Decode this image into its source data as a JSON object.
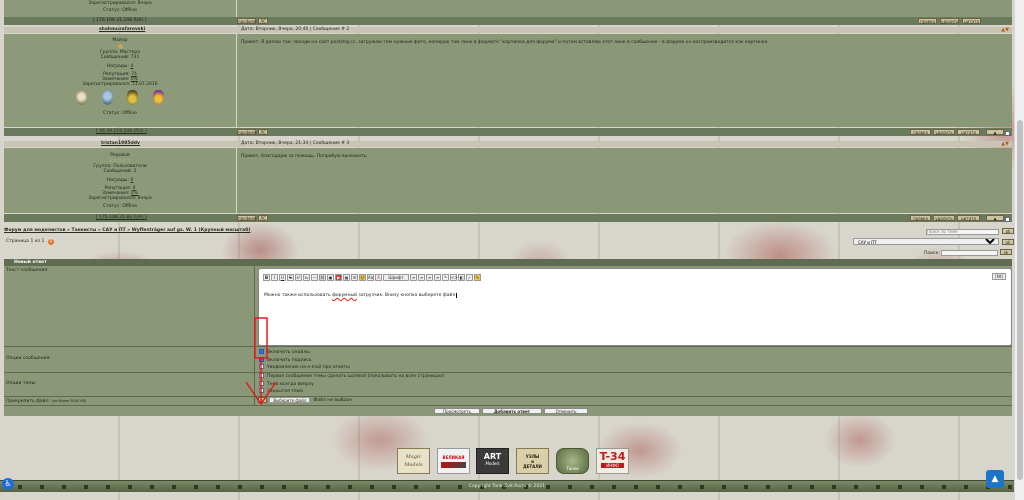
{
  "post0": {
    "registered": "Зарегистрировался: Вчера",
    "status": "Статус: Offline",
    "ip": "[ 176.108.31.248 (UA) ]",
    "btn_profile": "профиль",
    "btn_pm": "ЛС",
    "btn_edit": "правка",
    "btn_quote": "цитата"
  },
  "post1": {
    "username": "shahmuzafarovski",
    "rank": "Майор",
    "group": "Группа: Мастера",
    "messages": "Сообщений: 731",
    "awards_label": "Награды:",
    "awards_value": "4",
    "reputation_label": "Репутация:",
    "reputation_value": "74",
    "remarks_label": "Замечания:",
    "remarks_value": "0%",
    "registered": "Зарегистрировался: 11.07.2016",
    "status": "Статус: Offline",
    "meta": "Дата: Вторник, Вчера, 20:40 | Сообщение # 2",
    "text": "Привет. Я делаю так: заходи на сайт postimg.cc, загружаю там нужные фото, копирую там линк в формате \"картинка для форума\" и потом вставляю этот линк в сообщение - в форуме он воспроизводится как картинка.",
    "ip": "[ 46.39.219.248 (RU) ]",
    "btn_profile": "профиль",
    "btn_pm": "ЛС",
    "btn_edit": "правка",
    "btn_delete": "удалить",
    "btn_quote": "цитата"
  },
  "post2": {
    "username": "tristan1985ddv",
    "rank": "Рядовой",
    "group": "Группа: Пользователи",
    "messages": "Сообщений: 2",
    "awards_label": "Награды:",
    "awards_value": "0",
    "reputation_label": "Репутация:",
    "reputation_value": "0",
    "remarks_label": "Замечания:",
    "remarks_value": "0%",
    "registered": "Зарегистрировался: Вчера",
    "status": "Статус: Offline",
    "meta": "Дата: Вторник, Вчера, 21:34 | Сообщение # 3",
    "text": "Привет, благодарю за помощь. Попробую выложить.",
    "ip": "[ 176.108.31.82 (UA) ]",
    "btn_profile": "профиль",
    "btn_pm": "ЛС",
    "btn_edit": "правка",
    "btn_delete": "удалить",
    "btn_quote": "цитата"
  },
  "breadcrumb": "Форум для моделистов » Танкисты » САУ и ПТ » Wyffenträger auf gs. W. 1 (Крупный масштаб)",
  "pages_label": "Страница 1 из 1",
  "page_current": "1",
  "search_placeholder": "Поиск по теме",
  "btn_ok": "ok",
  "forum_select_value": "САУ и ПТ",
  "search2_label": "Поиск:",
  "reply": {
    "header": "Новый ответ",
    "text_label": "Текст сообщения:",
    "toolbar_font": "Шрифт",
    "toolbar_right": "[Nt]",
    "editor_text_before": "Можно также использовать ",
    "editor_link": "форумный",
    "editor_text_after": " загрузчик. Внизу кнопка выберете файл",
    "options_label": "Опции сообщения:",
    "opt_smiles": "Включить смайлы",
    "opt_signature": "Включить подпись",
    "opt_notify": "Уведомление на e-mail про ответы",
    "topic_options_label": "Опции темы:",
    "topic_opt1": "Первое сообщение темы сделать шапкой (показывать на всех страницах)",
    "topic_opt2": "Тема всегда вверху",
    "topic_opt3": "Закрытая тема",
    "attach_label": "Прикрепить файл:",
    "attach_limit": "(не более 5000 Кб)",
    "attach_plus": "+",
    "choose_file": "Выберите файл",
    "no_file": "Файл не выбран",
    "btn_preview": "Просмотреть",
    "btn_submit": "Добавить ответ",
    "btn_cancel": "Отменить"
  },
  "logos": {
    "l1a": "Magic",
    "l1b": "Models",
    "l2": "ВЕЛИКАЯ",
    "l3a": "ART",
    "l3b": "Models",
    "l4a": "УЗЛЫ",
    "l4b": "и",
    "l4c": "ДЕТАЛИ",
    "l5": "Танки",
    "l6a": "T-34",
    "l6b": "ИНФО"
  },
  "footer": "Copyright Tank-Zvit.Ru/ru © 2021",
  "colors": {
    "olive_bar": "#6b7a5d",
    "panel": "#8b9878",
    "annotation_red": "#e01d1d",
    "checkbox_blue": "#2a7be4"
  }
}
